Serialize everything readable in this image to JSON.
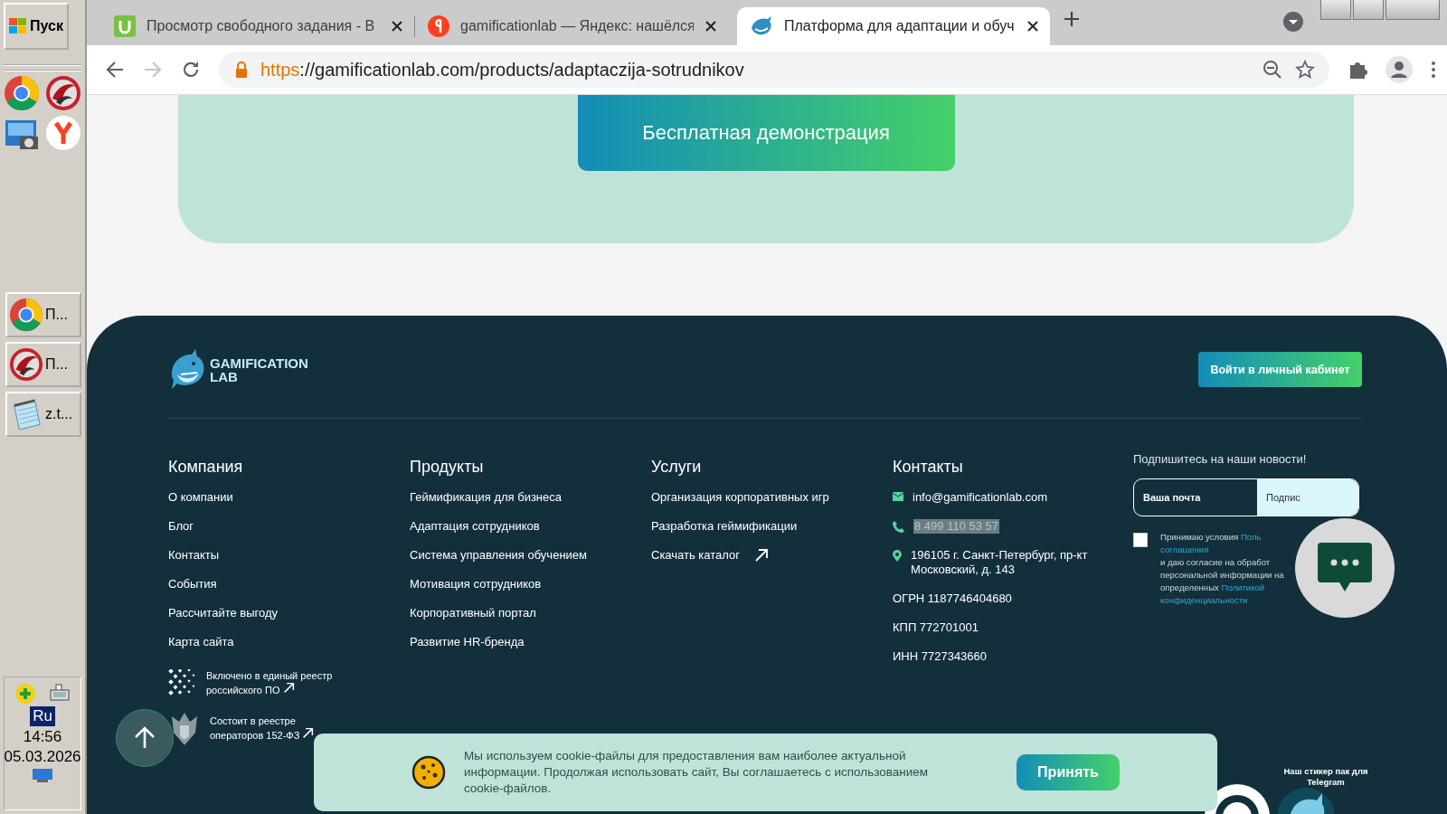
{
  "taskbar": {
    "start": "Пуск",
    "windows": [
      {
        "kind": "browser",
        "label": "П..."
      },
      {
        "kind": "security",
        "label": "П..."
      },
      {
        "kind": "notepad",
        "label": "z.t..."
      }
    ],
    "tray": {
      "language": "Ru",
      "time": "14:56",
      "date": "05.03.2026"
    }
  },
  "browser": {
    "tabs": [
      {
        "kind": "letter-site",
        "title": "Просмотр свободного задания - В",
        "selected": false
      },
      {
        "kind": "search",
        "title": "gamificationlab — Яндекс: нашёлся",
        "selected": false
      },
      {
        "kind": "mascot",
        "title": "Платформа для адаптации и обуч",
        "selected": true
      }
    ],
    "navigation": {
      "back_disabled": false,
      "forward_disabled": true
    },
    "url": {
      "scheme": "https",
      "rest": "://gamificationlab.com/products/adaptaczija-sotrudnikov"
    }
  },
  "page": {
    "demo_button": "Бесплатная демонстрация",
    "footer": {
      "logo": {
        "line_1": "GAMIFICATION",
        "line_2": "LAB"
      },
      "login_button": "Войти в личный кабинет",
      "columns": [
        {
          "heading": "Компания",
          "links": [
            {
              "kind": "link",
              "label": "О компании"
            },
            {
              "kind": "link",
              "label": "Блог"
            },
            {
              "kind": "link",
              "label": "Контакты"
            },
            {
              "kind": "link",
              "label": "События"
            },
            {
              "kind": "link",
              "label": "Рассчитайте выгоду"
            },
            {
              "kind": "link",
              "label": "Карта сайта"
            }
          ],
          "registries": [
            {
              "kind": "software",
              "text": "Включено в единый реестр российского ПО"
            },
            {
              "kind": "emblem",
              "text": "Состоит в реестре операторов 152-ФЗ"
            }
          ]
        },
        {
          "heading": "Продукты",
          "links": [
            {
              "kind": "link",
              "label": "Геймификация для бизнеса"
            },
            {
              "kind": "link",
              "label": "Адаптация сотрудников"
            },
            {
              "kind": "link",
              "label": "Система управления обучением"
            },
            {
              "kind": "link",
              "label": "Мотивация сотрудников"
            },
            {
              "kind": "link",
              "label": "Корпоративный портал"
            },
            {
              "kind": "link",
              "label": "Развитие HR-бренда"
            }
          ]
        },
        {
          "heading": "Услуги",
          "links": [
            {
              "kind": "link",
              "label": "Организация корпоративных игр"
            },
            {
              "kind": "link",
              "label": "Разработка геймификации"
            },
            {
              "kind": "external",
              "label": "Скачать каталог"
            }
          ]
        }
      ],
      "contacts": {
        "heading": "Контакты",
        "items": [
          {
            "kind": "email",
            "text": "info@gamificationlab.com",
            "highlighted": false
          },
          {
            "kind": "phone",
            "text": "8 499 110 53 57",
            "highlighted": true
          },
          {
            "kind": "address",
            "text": "196105 г. Санкт-Петербург, пр-кт Московский, д. 143",
            "highlighted": false
          },
          {
            "kind": "plain",
            "text": "ОГРН 1187746404680",
            "highlighted": false
          },
          {
            "kind": "plain",
            "text": "КПП 772701001",
            "highlighted": false
          },
          {
            "kind": "plain",
            "text": "ИНН 7727343660",
            "highlighted": false
          }
        ]
      },
      "subscribe": {
        "title": "Подпишитесь на наши новости!",
        "placeholder": "Ваша почта",
        "button": "Подпис",
        "checked": false,
        "consent_lines": [
          [
            {
              "text": "Принимаю условия ",
              "link": false
            },
            {
              "text": "Поль",
              "link": true
            }
          ],
          [
            {
              "text": "соглашения",
              "link": true
            }
          ],
          [
            {
              "text": "и даю согласие на обработ",
              "link": false
            }
          ],
          [
            {
              "text": "персональной информации на",
              "link": false
            }
          ],
          [
            {
              "text": "определенных ",
              "link": false
            },
            {
              "text": "Политикой",
              "link": true
            }
          ],
          [
            {
              "text": "конфиденциальности",
              "link": true
            }
          ]
        ]
      },
      "sticker": "Наш стикер пак для Telegram"
    },
    "cookie": {
      "text": "Мы используем cookie-файлы для предоставления вам наиболее актуальной информации. Продолжая использовать сайт, Вы соглашаетесь с использованием cookie-файлов.",
      "button": "Принять"
    }
  }
}
